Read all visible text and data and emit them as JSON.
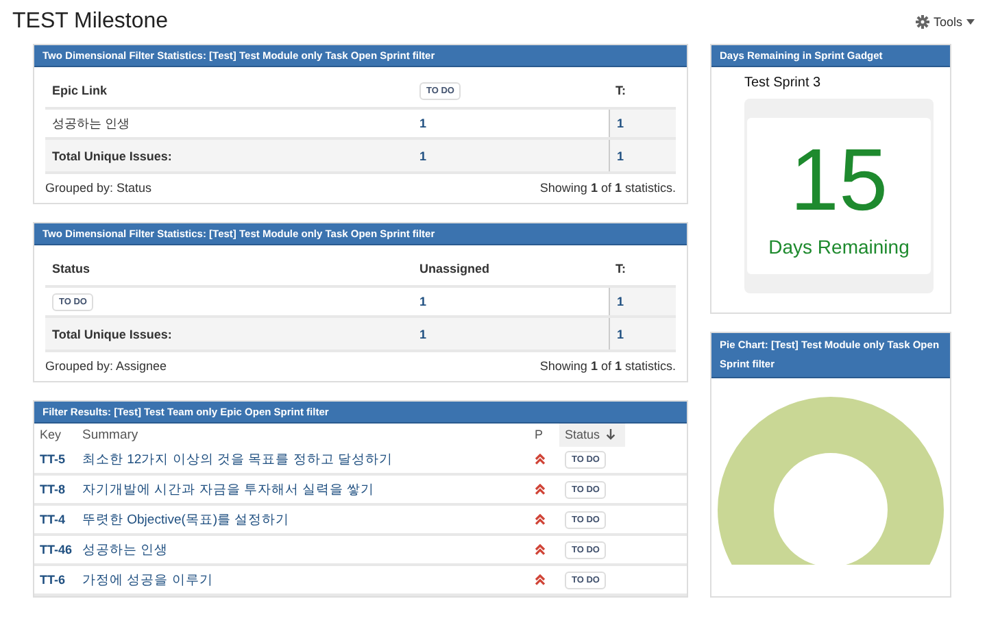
{
  "page": {
    "title": "TEST Milestone",
    "tools_label": "Tools"
  },
  "stat_gadgets": [
    {
      "title": "Two Dimensional Filter Statistics: [Test] Test Module only Task Open Sprint filter",
      "columns": [
        {
          "text": "Epic Link",
          "kind": "text"
        },
        {
          "text": "TO DO",
          "kind": "lozenge"
        },
        {
          "text": "T:",
          "kind": "text"
        }
      ],
      "rows": [
        {
          "label": {
            "text": "성공하는 인생",
            "kind": "text"
          },
          "values": [
            "1",
            "1"
          ]
        }
      ],
      "total": {
        "label": "Total Unique Issues:",
        "values": [
          "1",
          "1"
        ]
      },
      "grouped_by": "Grouped by: Status",
      "showing": "Showing **1** of **1** statistics."
    },
    {
      "title": "Two Dimensional Filter Statistics: [Test] Test Module only Task Open Sprint filter",
      "columns": [
        {
          "text": "Status",
          "kind": "text"
        },
        {
          "text": "Unassigned",
          "kind": "text"
        },
        {
          "text": "T:",
          "kind": "text"
        }
      ],
      "rows": [
        {
          "label": {
            "text": "TO DO",
            "kind": "lozenge"
          },
          "values": [
            "1",
            "1"
          ]
        }
      ],
      "total": {
        "label": "Total Unique Issues:",
        "values": [
          "1",
          "1"
        ]
      },
      "grouped_by": "Grouped by: Assignee",
      "showing": "Showing **1** of **1** statistics."
    }
  ],
  "filter_results": {
    "title": "Filter Results: [Test] Test Team only Epic Open Sprint filter",
    "columns": [
      "Key",
      "Summary",
      "P",
      "Status"
    ],
    "rows": [
      {
        "key": "TT-5",
        "summary": "최소한 12가지 이상의 것을 목표를 정하고 달성하기",
        "status": "TO DO"
      },
      {
        "key": "TT-8",
        "summary": "자기개발에 시간과 자금을 투자해서 실력을 쌓기",
        "status": "TO DO"
      },
      {
        "key": "TT-4",
        "summary": "뚜렷한 Objective(목표)를 설정하기",
        "status": "TO DO"
      },
      {
        "key": "TT-46",
        "summary": "성공하는 인생",
        "status": "TO DO"
      },
      {
        "key": "TT-6",
        "summary": "가정에 성공을 이루기",
        "status": "TO DO"
      }
    ]
  },
  "days_gadget": {
    "title": "Days Remaining in Sprint Gadget",
    "sprint": "Test Sprint 3",
    "days": "15",
    "caption": "Days Remaining"
  },
  "pie_gadget": {
    "title": "Pie Chart: [Test] Test Module only Task Open Sprint filter"
  }
}
